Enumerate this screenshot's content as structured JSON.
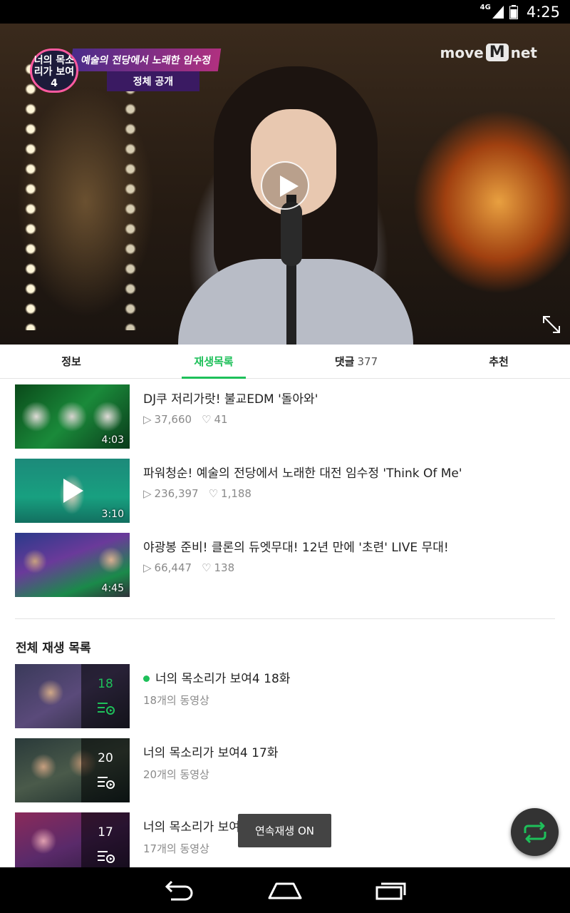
{
  "status_bar": {
    "network": "4G",
    "time": "4:25"
  },
  "video": {
    "caption_logo": "너의 목소리가 보여 4",
    "caption_line1": "예술의 전당에서 노래한 임수정",
    "caption_line2": "정체 공개",
    "brand_prefix": "move",
    "brand_m": "M",
    "brand_suffix": "net"
  },
  "tabs": [
    {
      "label": "정보",
      "count": ""
    },
    {
      "label": "재생목록",
      "count": ""
    },
    {
      "label": "댓글",
      "count": "377"
    },
    {
      "label": "추천",
      "count": ""
    }
  ],
  "clips": [
    {
      "title": "DJ쿠 저리가랏! 불교EDM '돌아와'",
      "views": "37,660",
      "likes": "41",
      "duration": "4:03"
    },
    {
      "title": "파워청순! 예술의 전당에서 노래한 대전 임수정 'Think Of Me'",
      "views": "236,397",
      "likes": "1,188",
      "duration": "3:10"
    },
    {
      "title": "야광봉 준비! 클론의 듀엣무대! 12년 만에 '초련' LIVE 무대!",
      "views": "66,447",
      "likes": "138",
      "duration": "4:45"
    }
  ],
  "playlist_section_title": "전체 재생 목록",
  "playlists": [
    {
      "title": "너의 목소리가 보여4 18화",
      "count_label": "18개의 동영상",
      "count": "18"
    },
    {
      "title": "너의 목소리가 보여4 17화",
      "count_label": "20개의 동영상",
      "count": "20"
    },
    {
      "title": "너의 목소리가 보여4 16화",
      "count_label": "17개의 동영상",
      "count": "17"
    }
  ],
  "toast": "연속재생 ON",
  "colors": {
    "accent": "#1ec05a",
    "text": "#222222",
    "meta": "#8a8a8a"
  }
}
